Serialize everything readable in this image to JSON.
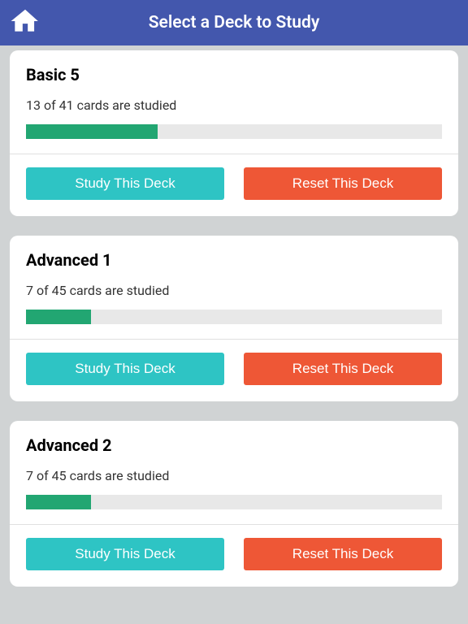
{
  "header": {
    "title": "Select a Deck to Study"
  },
  "buttons": {
    "study": "Study This Deck",
    "reset": "Reset This Deck"
  },
  "decks": [
    {
      "name": "Basic 5",
      "status": "13 of 41 cards are studied",
      "progress": 31.7
    },
    {
      "name": "Advanced 1",
      "status": "7 of 45 cards are studied",
      "progress": 15.6
    },
    {
      "name": "Advanced 2",
      "status": "7 of 45 cards are studied",
      "progress": 15.6
    }
  ]
}
